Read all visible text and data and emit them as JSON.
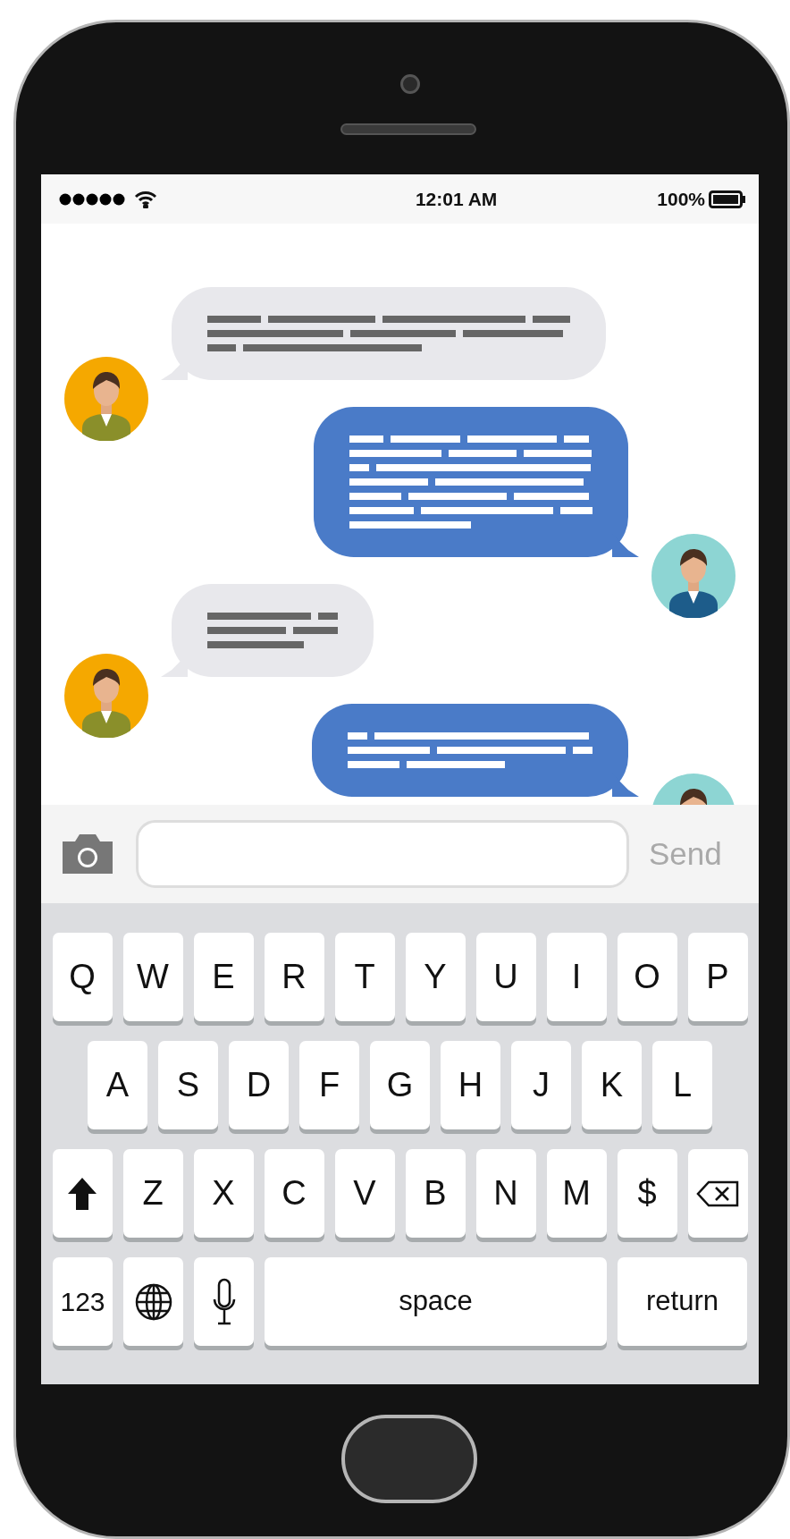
{
  "status_bar": {
    "time": "12:01 AM",
    "battery": "100%"
  },
  "messages": [
    {
      "kind": "incoming"
    },
    {
      "kind": "outgoing"
    },
    {
      "kind": "incoming"
    },
    {
      "kind": "outgoing"
    }
  ],
  "composer": {
    "send": "Send"
  },
  "keyboard": {
    "rows": [
      [
        {
          "kind": "char",
          "label": "Q"
        },
        {
          "kind": "char",
          "label": "W"
        },
        {
          "kind": "char",
          "label": "E"
        },
        {
          "kind": "char",
          "label": "R"
        },
        {
          "kind": "char",
          "label": "T"
        },
        {
          "kind": "char",
          "label": "Y"
        },
        {
          "kind": "char",
          "label": "U"
        },
        {
          "kind": "char",
          "label": "I"
        },
        {
          "kind": "char",
          "label": "O"
        },
        {
          "kind": "char",
          "label": "P"
        }
      ],
      [
        {
          "kind": "char",
          "label": "A"
        },
        {
          "kind": "char",
          "label": "S"
        },
        {
          "kind": "char",
          "label": "D"
        },
        {
          "kind": "char",
          "label": "F"
        },
        {
          "kind": "char",
          "label": "G"
        },
        {
          "kind": "char",
          "label": "H"
        },
        {
          "kind": "char",
          "label": "J"
        },
        {
          "kind": "char",
          "label": "K"
        },
        {
          "kind": "char",
          "label": "L"
        }
      ],
      [
        {
          "kind": "shift"
        },
        {
          "kind": "char",
          "label": "Z"
        },
        {
          "kind": "char",
          "label": "X"
        },
        {
          "kind": "char",
          "label": "C"
        },
        {
          "kind": "char",
          "label": "V"
        },
        {
          "kind": "char",
          "label": "B"
        },
        {
          "kind": "char",
          "label": "N"
        },
        {
          "kind": "char",
          "label": "M"
        },
        {
          "kind": "char",
          "label": "$"
        },
        {
          "kind": "backspace"
        }
      ]
    ],
    "bottom_row": [
      {
        "kind": "small",
        "label": "123"
      },
      {
        "kind": "globe"
      },
      {
        "kind": "mic"
      },
      {
        "kind": "space",
        "label": "space"
      },
      {
        "kind": "return",
        "label": "return"
      }
    ]
  }
}
